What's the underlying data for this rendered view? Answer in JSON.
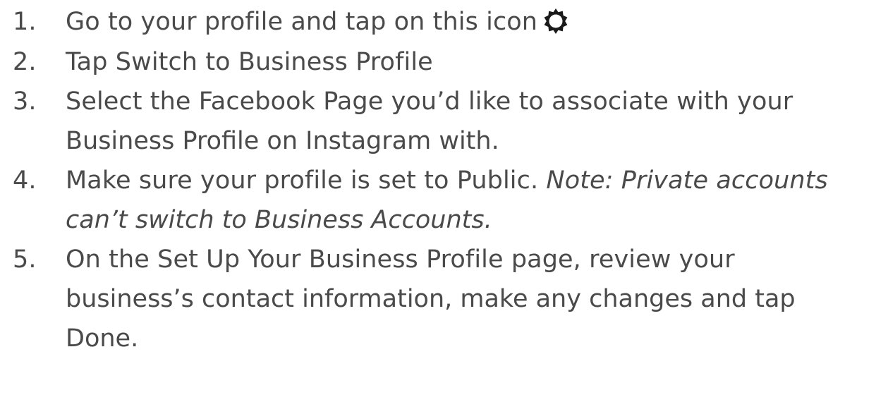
{
  "steps": [
    {
      "number": "1.",
      "text": "Go to your profile and tap on this icon",
      "icon": "gear-icon"
    },
    {
      "number": "2.",
      "text": "Tap Switch to Business Profile"
    },
    {
      "number": "3.",
      "line1": "Select the Facebook Page you’d like to associate with your",
      "line2": "Business Profile on Instagram with."
    },
    {
      "number": "4.",
      "line1_plain": "Make sure your profile is set to Public. ",
      "line1_italic": "Note: Private accounts",
      "line2_italic": "can’t switch to Business Accounts."
    },
    {
      "number": "5.",
      "line1": "On the Set Up Your Business Profile page, review your",
      "line2": "business’s contact information, make any changes and tap",
      "line3": "Done."
    }
  ],
  "colors": {
    "text": "#4a4a4a",
    "icon": "#1a1a1a",
    "background": "#ffffff"
  }
}
